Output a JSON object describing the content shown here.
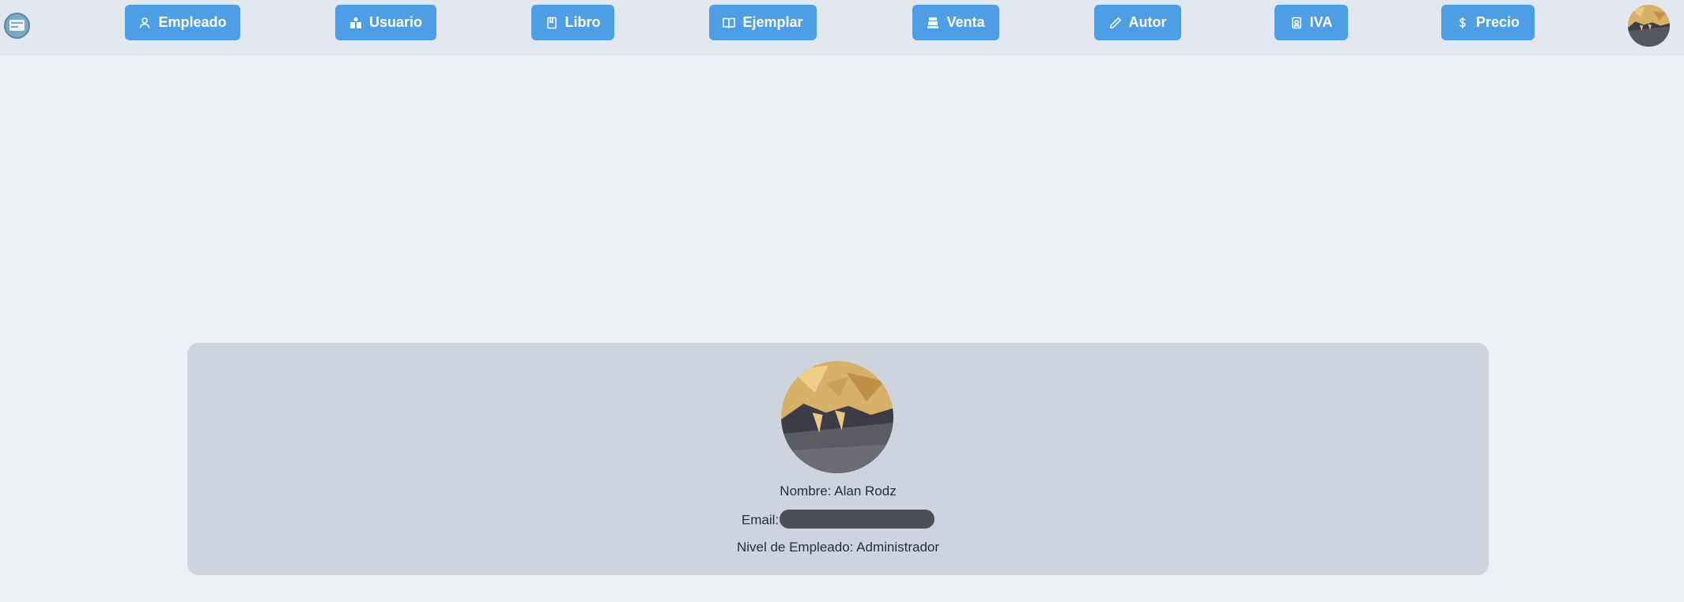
{
  "navbar": {
    "logo_icon": "browser-window-icon",
    "buttons": [
      {
        "label": "Empleado",
        "icon": "person-icon"
      },
      {
        "label": "Usuario",
        "icon": "users-icon"
      },
      {
        "label": "Libro",
        "icon": "book-icon"
      },
      {
        "label": "Ejemplar",
        "icon": "open-book-icon"
      },
      {
        "label": "Venta",
        "icon": "cash-register-icon"
      },
      {
        "label": "Autor",
        "icon": "pencil-icon"
      },
      {
        "label": "IVA",
        "icon": "receipt-icon"
      },
      {
        "label": "Precio",
        "icon": "dollar-icon"
      }
    ],
    "avatar": "user-avatar"
  },
  "profile": {
    "name_line": "Nombre: Alan Rodz",
    "email_label": "Email:",
    "email_value": "redacted",
    "level_line": "Nivel de Empleado: Administrador"
  },
  "colors": {
    "navbar_bg": "#e2e7f0",
    "button_bg": "#4e9ee6",
    "page_bg": "#edf1f5",
    "card_bg": "#cdd4de"
  }
}
